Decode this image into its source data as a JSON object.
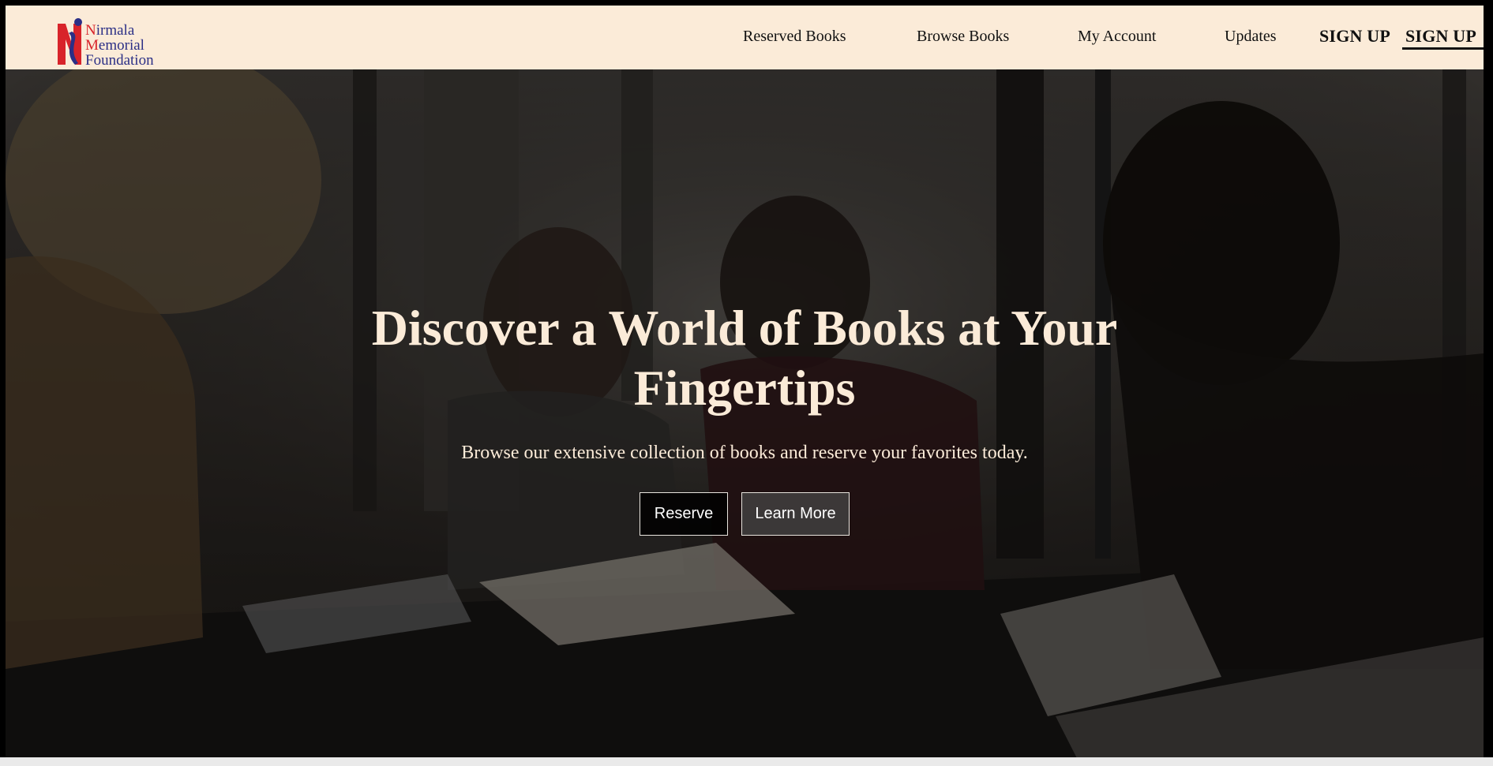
{
  "logo": {
    "lines": [
      {
        "initial": "N",
        "rest": "irmala"
      },
      {
        "initial": "M",
        "rest": "emorial"
      },
      {
        "initial": "F",
        "rest": "oundation"
      }
    ]
  },
  "nav": {
    "items": [
      {
        "label": "Reserved Books"
      },
      {
        "label": "Browse Books"
      },
      {
        "label": "My Account"
      },
      {
        "label": "Updates"
      }
    ],
    "signup_1": "SIGN UP",
    "signup_2": "SIGN UP"
  },
  "hero": {
    "title_line1": "Discover a World of Books at Your",
    "title_line2": "Fingertips",
    "subtitle": "Browse our extensive collection of books and reserve your favorites today.",
    "buttons": {
      "reserve": "Reserve",
      "learn_more": "Learn More"
    }
  },
  "colors": {
    "header_bg": "#fbebd8",
    "hero_text": "#fbebd8",
    "logo_blue": "#2b2f86",
    "logo_red": "#d8232a"
  }
}
